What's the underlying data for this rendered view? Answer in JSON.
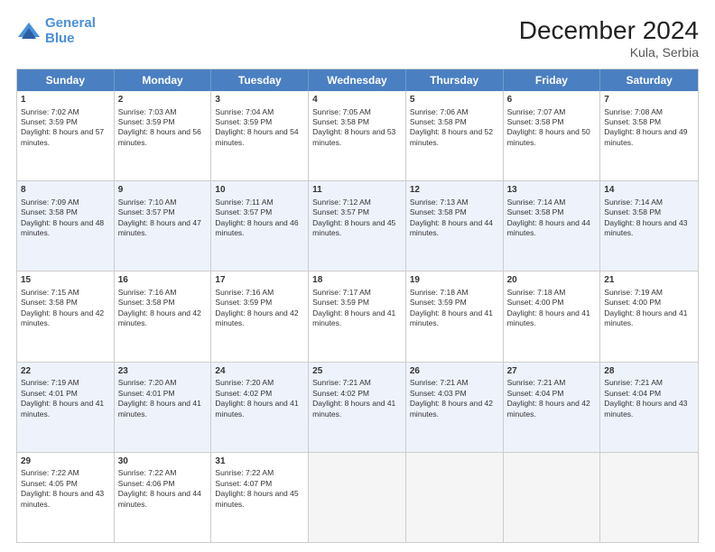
{
  "header": {
    "logo_line1": "General",
    "logo_line2": "Blue",
    "month_title": "December 2024",
    "location": "Kula, Serbia"
  },
  "days_of_week": [
    "Sunday",
    "Monday",
    "Tuesday",
    "Wednesday",
    "Thursday",
    "Friday",
    "Saturday"
  ],
  "rows": [
    [
      {
        "day": "1",
        "rise": "Sunrise: 7:02 AM",
        "set": "Sunset: 3:59 PM",
        "day_text": "Daylight: 8 hours and 57 minutes.",
        "empty": false
      },
      {
        "day": "2",
        "rise": "Sunrise: 7:03 AM",
        "set": "Sunset: 3:59 PM",
        "day_text": "Daylight: 8 hours and 56 minutes.",
        "empty": false
      },
      {
        "day": "3",
        "rise": "Sunrise: 7:04 AM",
        "set": "Sunset: 3:59 PM",
        "day_text": "Daylight: 8 hours and 54 minutes.",
        "empty": false
      },
      {
        "day": "4",
        "rise": "Sunrise: 7:05 AM",
        "set": "Sunset: 3:58 PM",
        "day_text": "Daylight: 8 hours and 53 minutes.",
        "empty": false
      },
      {
        "day": "5",
        "rise": "Sunrise: 7:06 AM",
        "set": "Sunset: 3:58 PM",
        "day_text": "Daylight: 8 hours and 52 minutes.",
        "empty": false
      },
      {
        "day": "6",
        "rise": "Sunrise: 7:07 AM",
        "set": "Sunset: 3:58 PM",
        "day_text": "Daylight: 8 hours and 50 minutes.",
        "empty": false
      },
      {
        "day": "7",
        "rise": "Sunrise: 7:08 AM",
        "set": "Sunset: 3:58 PM",
        "day_text": "Daylight: 8 hours and 49 minutes.",
        "empty": false
      }
    ],
    [
      {
        "day": "8",
        "rise": "Sunrise: 7:09 AM",
        "set": "Sunset: 3:58 PM",
        "day_text": "Daylight: 8 hours and 48 minutes.",
        "empty": false
      },
      {
        "day": "9",
        "rise": "Sunrise: 7:10 AM",
        "set": "Sunset: 3:57 PM",
        "day_text": "Daylight: 8 hours and 47 minutes.",
        "empty": false
      },
      {
        "day": "10",
        "rise": "Sunrise: 7:11 AM",
        "set": "Sunset: 3:57 PM",
        "day_text": "Daylight: 8 hours and 46 minutes.",
        "empty": false
      },
      {
        "day": "11",
        "rise": "Sunrise: 7:12 AM",
        "set": "Sunset: 3:57 PM",
        "day_text": "Daylight: 8 hours and 45 minutes.",
        "empty": false
      },
      {
        "day": "12",
        "rise": "Sunrise: 7:13 AM",
        "set": "Sunset: 3:58 PM",
        "day_text": "Daylight: 8 hours and 44 minutes.",
        "empty": false
      },
      {
        "day": "13",
        "rise": "Sunrise: 7:14 AM",
        "set": "Sunset: 3:58 PM",
        "day_text": "Daylight: 8 hours and 44 minutes.",
        "empty": false
      },
      {
        "day": "14",
        "rise": "Sunrise: 7:14 AM",
        "set": "Sunset: 3:58 PM",
        "day_text": "Daylight: 8 hours and 43 minutes.",
        "empty": false
      }
    ],
    [
      {
        "day": "15",
        "rise": "Sunrise: 7:15 AM",
        "set": "Sunset: 3:58 PM",
        "day_text": "Daylight: 8 hours and 42 minutes.",
        "empty": false
      },
      {
        "day": "16",
        "rise": "Sunrise: 7:16 AM",
        "set": "Sunset: 3:58 PM",
        "day_text": "Daylight: 8 hours and 42 minutes.",
        "empty": false
      },
      {
        "day": "17",
        "rise": "Sunrise: 7:16 AM",
        "set": "Sunset: 3:59 PM",
        "day_text": "Daylight: 8 hours and 42 minutes.",
        "empty": false
      },
      {
        "day": "18",
        "rise": "Sunrise: 7:17 AM",
        "set": "Sunset: 3:59 PM",
        "day_text": "Daylight: 8 hours and 41 minutes.",
        "empty": false
      },
      {
        "day": "19",
        "rise": "Sunrise: 7:18 AM",
        "set": "Sunset: 3:59 PM",
        "day_text": "Daylight: 8 hours and 41 minutes.",
        "empty": false
      },
      {
        "day": "20",
        "rise": "Sunrise: 7:18 AM",
        "set": "Sunset: 4:00 PM",
        "day_text": "Daylight: 8 hours and 41 minutes.",
        "empty": false
      },
      {
        "day": "21",
        "rise": "Sunrise: 7:19 AM",
        "set": "Sunset: 4:00 PM",
        "day_text": "Daylight: 8 hours and 41 minutes.",
        "empty": false
      }
    ],
    [
      {
        "day": "22",
        "rise": "Sunrise: 7:19 AM",
        "set": "Sunset: 4:01 PM",
        "day_text": "Daylight: 8 hours and 41 minutes.",
        "empty": false
      },
      {
        "day": "23",
        "rise": "Sunrise: 7:20 AM",
        "set": "Sunset: 4:01 PM",
        "day_text": "Daylight: 8 hours and 41 minutes.",
        "empty": false
      },
      {
        "day": "24",
        "rise": "Sunrise: 7:20 AM",
        "set": "Sunset: 4:02 PM",
        "day_text": "Daylight: 8 hours and 41 minutes.",
        "empty": false
      },
      {
        "day": "25",
        "rise": "Sunrise: 7:21 AM",
        "set": "Sunset: 4:02 PM",
        "day_text": "Daylight: 8 hours and 41 minutes.",
        "empty": false
      },
      {
        "day": "26",
        "rise": "Sunrise: 7:21 AM",
        "set": "Sunset: 4:03 PM",
        "day_text": "Daylight: 8 hours and 42 minutes.",
        "empty": false
      },
      {
        "day": "27",
        "rise": "Sunrise: 7:21 AM",
        "set": "Sunset: 4:04 PM",
        "day_text": "Daylight: 8 hours and 42 minutes.",
        "empty": false
      },
      {
        "day": "28",
        "rise": "Sunrise: 7:21 AM",
        "set": "Sunset: 4:04 PM",
        "day_text": "Daylight: 8 hours and 43 minutes.",
        "empty": false
      }
    ],
    [
      {
        "day": "29",
        "rise": "Sunrise: 7:22 AM",
        "set": "Sunset: 4:05 PM",
        "day_text": "Daylight: 8 hours and 43 minutes.",
        "empty": false
      },
      {
        "day": "30",
        "rise": "Sunrise: 7:22 AM",
        "set": "Sunset: 4:06 PM",
        "day_text": "Daylight: 8 hours and 44 minutes.",
        "empty": false
      },
      {
        "day": "31",
        "rise": "Sunrise: 7:22 AM",
        "set": "Sunset: 4:07 PM",
        "day_text": "Daylight: 8 hours and 45 minutes.",
        "empty": false
      },
      {
        "day": "",
        "rise": "",
        "set": "",
        "day_text": "",
        "empty": true
      },
      {
        "day": "",
        "rise": "",
        "set": "",
        "day_text": "",
        "empty": true
      },
      {
        "day": "",
        "rise": "",
        "set": "",
        "day_text": "",
        "empty": true
      },
      {
        "day": "",
        "rise": "",
        "set": "",
        "day_text": "",
        "empty": true
      }
    ]
  ]
}
